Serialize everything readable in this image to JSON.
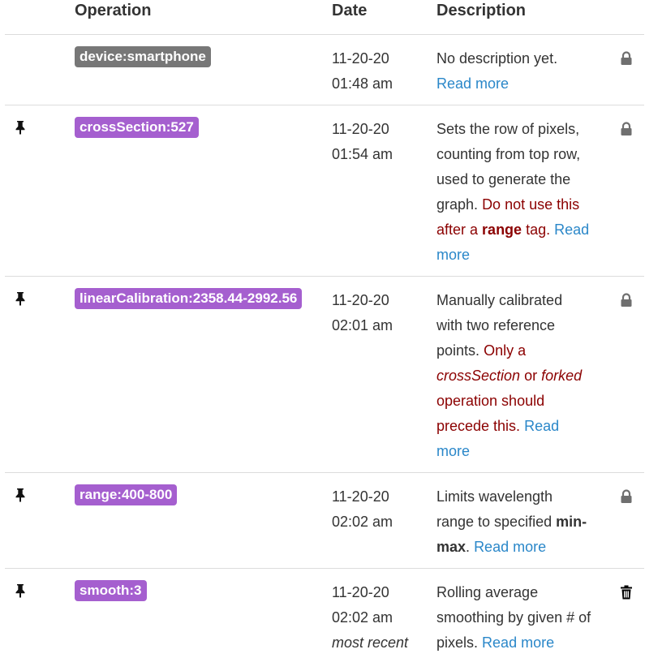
{
  "headers": {
    "operation": "Operation",
    "date": "Date",
    "description": "Description"
  },
  "colors": {
    "tag_default": "#777777",
    "tag_purple": "#a55fcf",
    "link": "#2a87c9",
    "warning": "#8b0000"
  },
  "rows": [
    {
      "pinned": false,
      "tag": "device:smartphone",
      "tag_color": "#777777",
      "date": "11-20-20",
      "time": "01:48 am",
      "recent": "",
      "desc_plain": "No description yet.",
      "read_more": "Read more",
      "action_icon": "lock-icon"
    },
    {
      "pinned": true,
      "tag": "crossSection:527",
      "tag_color": "#a55fcf",
      "date": "11-20-20",
      "time": "01:54 am",
      "recent": "",
      "desc_plain": "Sets the row of pixels, counting from top row, used to generate the graph.",
      "warn_pre": "Do not use this after a",
      "warn_bold": "range",
      "warn_post": "tag.",
      "read_more": "Read more",
      "action_icon": "lock-icon"
    },
    {
      "pinned": true,
      "tag": "linearCalibration:2358.44-2992.56",
      "tag_color": "#a55fcf",
      "date": "11-20-20",
      "time": "02:01 am",
      "recent": "",
      "desc_plain": "Manually calibrated with two reference points.",
      "warn_pre": "Only a",
      "warn_em1": "crossSection",
      "warn_mid": "or",
      "warn_em2": "forked",
      "warn_post": "operation should precede this.",
      "read_more": "Read more",
      "action_icon": "lock-icon"
    },
    {
      "pinned": true,
      "tag": "range:400-800",
      "tag_color": "#a55fcf",
      "date": "11-20-20",
      "time": "02:02 am",
      "recent": "",
      "desc_plain": "Limits wavelength range to specified",
      "desc_bold": "min-max",
      "desc_end": ".",
      "read_more": "Read more",
      "action_icon": "lock-icon"
    },
    {
      "pinned": true,
      "tag": "smooth:3",
      "tag_color": "#a55fcf",
      "date": "11-20-20",
      "time": "02:02 am",
      "recent": "most recent",
      "desc_plain": "Rolling average smoothing by given # of pixels.",
      "read_more": "Read more",
      "action_icon": "trash-icon"
    }
  ]
}
